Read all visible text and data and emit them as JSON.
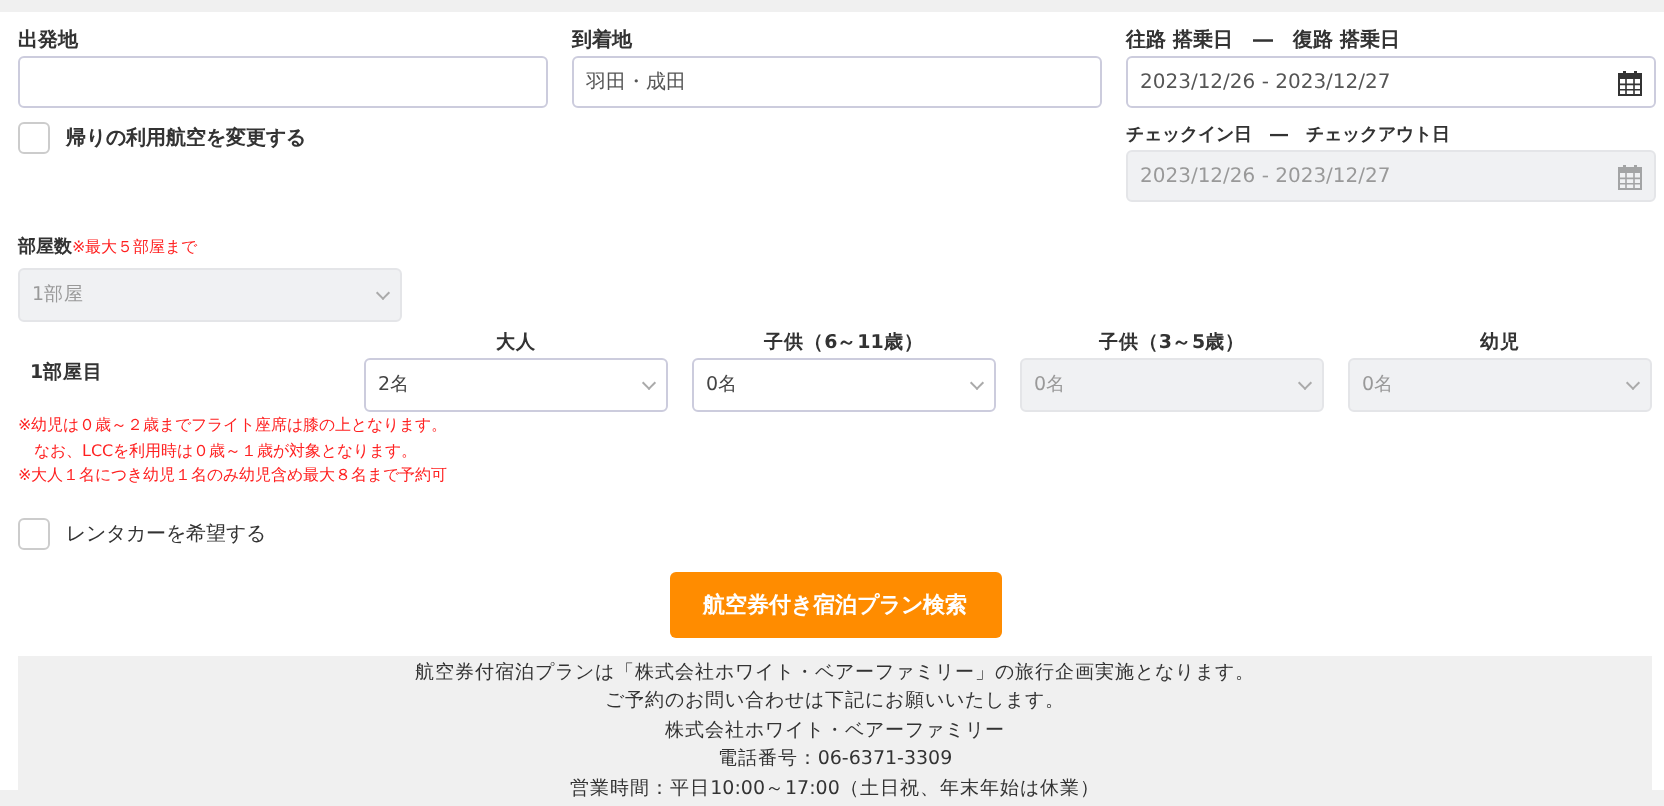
{
  "top_fields": [
    {
      "label": "出発地",
      "disabled": false,
      "calendar": false
    },
    {
      "label": "到着地",
      "value": "羽田・成田",
      "disabled": false,
      "calendar": false
    },
    {
      "label": "往路 搭乗日　―　復路 搭乗日",
      "value": "2023/12/26 - 2023/12/27",
      "disabled": false,
      "calendar": true
    }
  ],
  "return_airline_checkbox": {
    "label": "帰りの利用航空を変更する",
    "checked": false
  },
  "hotel_dates": {
    "label": "チェックイン日　―　チェックアウト日",
    "value": "2023/12/26 - 2023/12/27",
    "disabled": true,
    "calendar": true
  },
  "rooms": {
    "label": "部屋数",
    "note": "※最大５部屋まで",
    "value": "1部屋",
    "disabled": true
  },
  "room_1": {
    "label": "1部屋目",
    "guests": [
      {
        "label": "大人",
        "value": "2名",
        "disabled": false
      },
      {
        "label": "子供（6～11歳）",
        "value": "0名",
        "disabled": false
      },
      {
        "label": "子供（3～5歳）",
        "value": "0名",
        "disabled": true
      },
      {
        "label": "幼児",
        "value": "0名",
        "disabled": true
      }
    ]
  },
  "notes": [
    "※幼児は０歳～２歳までフライト座席は膝の上となります。",
    "　なお、LCCを利用時は０歳～１歳が対象となります。",
    "※大人１名につき幼児１名のみ幼児含め最大８名まで予約可"
  ],
  "rental_car_checkbox": {
    "label": "レンタカーを希望する",
    "checked": false
  },
  "search_button": "航空券付き宿泊プラン検索",
  "footer": [
    "航空券付宿泊プランは「株式会社ホワイト・ベアーファミリー」の旅行企画実施となります。",
    "ご予約のお問い合わせは下記にお願いいたします。",
    "株式会社ホワイト・ベアーファミリー",
    "電話番号：06-6371-3309",
    "営業時間：平日10:00～17:00（土日祝、年末年始は休業）"
  ]
}
